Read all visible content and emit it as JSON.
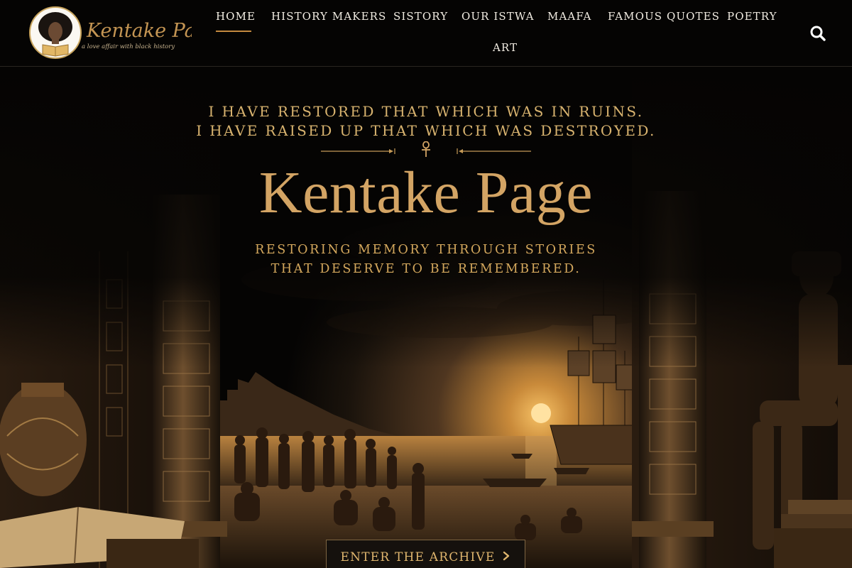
{
  "logo": {
    "wordmark": "Kentake Page",
    "tagline": "a love affair with black history"
  },
  "nav": {
    "items": [
      {
        "label": "HOME",
        "active": true
      },
      {
        "label": "HISTORY MAKERS",
        "active": false
      },
      {
        "label": "SISTORY",
        "active": false
      },
      {
        "label": "OUR ISTWA",
        "active": false
      },
      {
        "label": "MAAFA",
        "active": false
      },
      {
        "label": "FAMOUS QUOTES",
        "active": false
      },
      {
        "label": "POETRY",
        "active": false
      },
      {
        "label": "ART",
        "active": false
      }
    ],
    "search_icon": "search-icon"
  },
  "hero": {
    "tagline_line1": "I HAVE RESTORED THAT WHICH WAS IN RUINS.",
    "tagline_line2": "I HAVE RAISED UP THAT WHICH WAS DESTROYED.",
    "divider_icon": "ankh-icon",
    "title": "Kentake Page",
    "subtitle_line1": "RESTORING MEMORY THROUGH STORIES",
    "subtitle_line2": "THAT DESERVE TO BE REMEMBERED.",
    "cta_label": "ENTER THE ARCHIVE",
    "cta_icon": "chevron-right-icon"
  },
  "colors": {
    "accent_gold": "#d3a464",
    "header_bg": "#050403",
    "nav_text": "#f1ece2",
    "active_underline": "#c48a3f"
  }
}
